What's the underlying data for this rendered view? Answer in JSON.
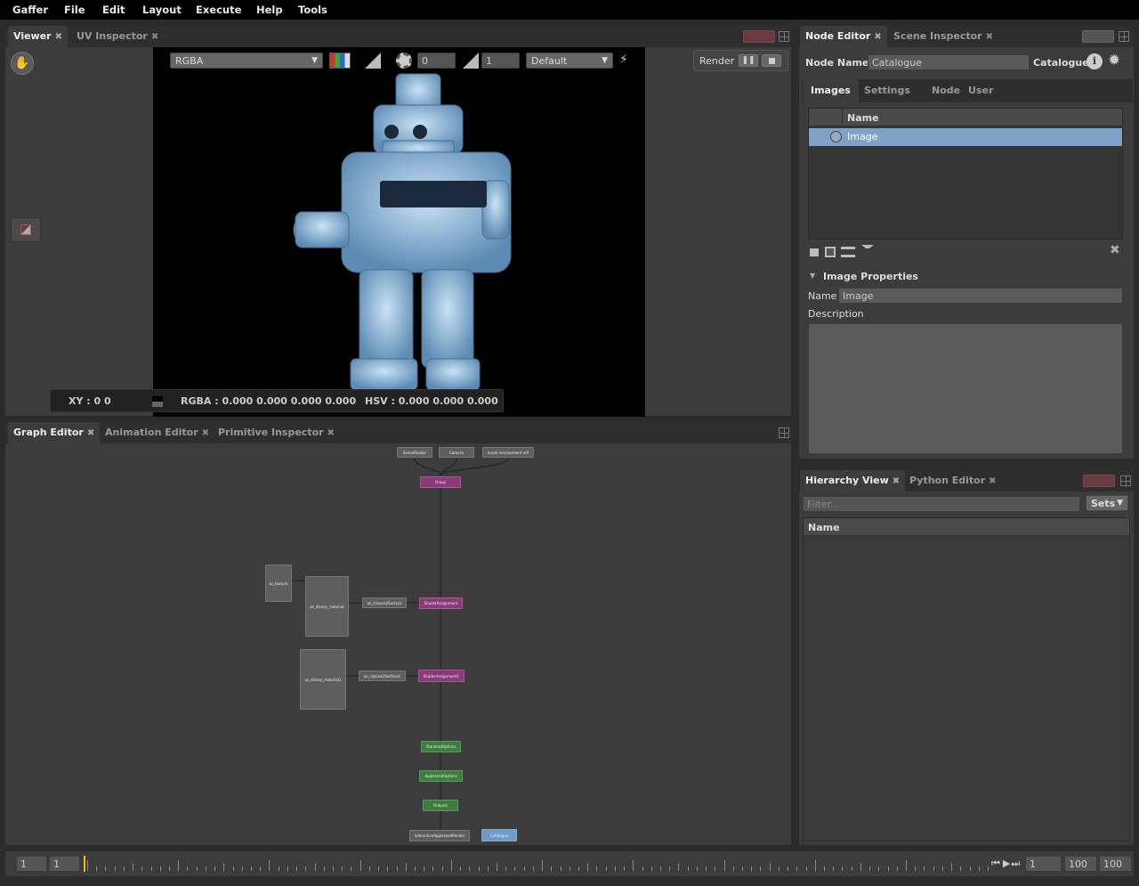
{
  "menu": [
    "Gaffer",
    "File",
    "Edit",
    "Layout",
    "Execute",
    "Help",
    "Tools"
  ],
  "viewer": {
    "tabs": [
      {
        "label": "Viewer",
        "close": "✖"
      },
      {
        "label": "UV Inspector",
        "close": "✖"
      }
    ],
    "channels": "RGBA",
    "exposure": "0",
    "gamma": "1",
    "display": "Default",
    "render_label": "Render",
    "pause_icon": "pause-icon",
    "stop_icon": "stop-icon",
    "status": {
      "xy": "XY : 0 0",
      "rgba": "RGBA : 0.000 0.000 0.000 0.000",
      "hsv": "HSV : 0.000 0.000 0.000"
    }
  },
  "node_editor": {
    "tabs": [
      {
        "label": "Node Editor",
        "close": "✖"
      },
      {
        "label": "Scene Inspector",
        "close": "✖"
      }
    ],
    "node_name_label": "Node Name",
    "node_name_value": "Catalogue",
    "node_type": "Catalogue",
    "subtabs": [
      "Images",
      "Settings",
      "Node",
      "User"
    ],
    "images_column": "Name",
    "images": [
      {
        "name": "Image",
        "selected": true
      }
    ],
    "section": "Image Properties",
    "name_label": "Name",
    "name_value": "Image",
    "description_label": "Description",
    "description_value": ""
  },
  "graph_editor": {
    "tabs": [
      {
        "label": "Graph Editor",
        "close": "✖"
      },
      {
        "label": "Animation Editor",
        "close": "✖"
      },
      {
        "label": "Primitive Inspector",
        "close": "✖"
      }
    ],
    "nodes": {
      "scenereader": "SceneReader",
      "camera": "Camera",
      "envlight": "hosek environment edf",
      "group": "Group",
      "as_texture": "as_texture",
      "disney1": "as_disney_material",
      "closure1": "as_closure2Surface",
      "assign1": "ShaderAssignment",
      "disney2": "as_disney_material1",
      "closure2": "as_closure2Surface1",
      "assign2": "ShaderAssignment1",
      "std_options": "StandardOptions",
      "as_options": "AppleseedOptions",
      "outputs": "Outputs",
      "render": "InteractiveAppleseedRender",
      "catalogue": "Catalogue"
    }
  },
  "hierarchy": {
    "tabs": [
      {
        "label": "Hierarchy View",
        "close": "✖"
      },
      {
        "label": "Python Editor",
        "close": "✖"
      }
    ],
    "filter_placeholder": "Filter...",
    "sets_label": "Sets",
    "column": "Name"
  },
  "timeline": {
    "start": "1",
    "current_start": "1",
    "frame": "1",
    "end": "100",
    "range_end": "100"
  },
  "colors": {
    "accent_blue": "#7fa3c8",
    "node_purple": "#8a3a78",
    "node_green": "#3d7d3d",
    "cursor_yellow": "#f0c000"
  }
}
